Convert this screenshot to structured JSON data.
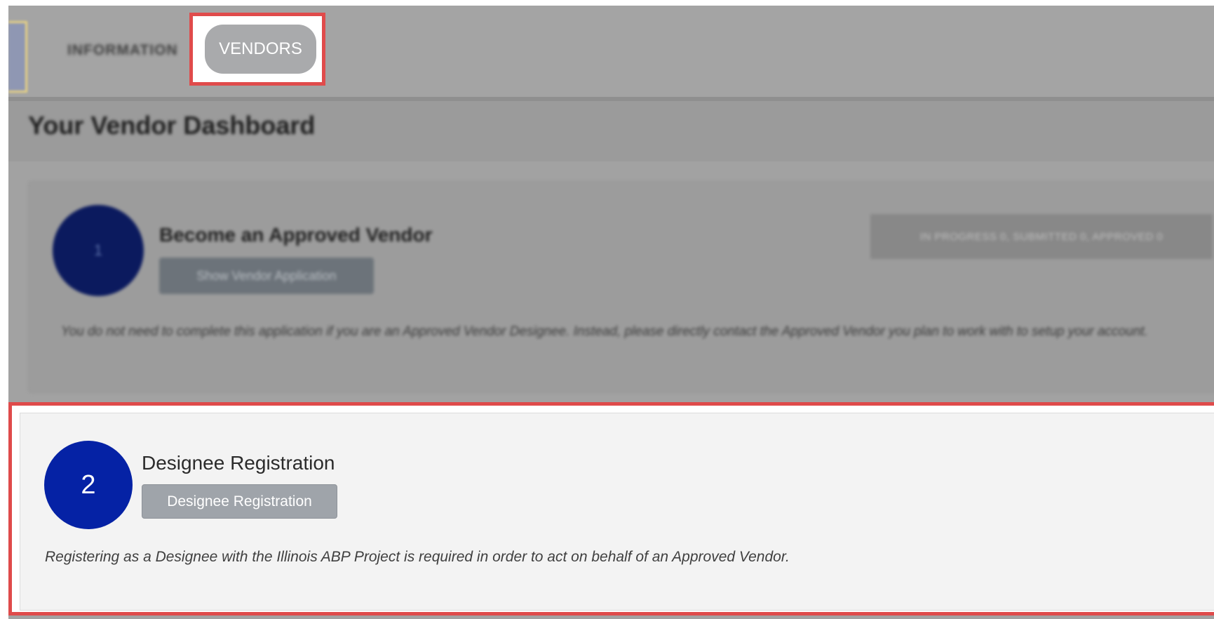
{
  "nav": {
    "information_label": "INFORMATION",
    "vendors_label": "VENDORS"
  },
  "dashboard": {
    "title": "Your Vendor Dashboard"
  },
  "cards": [
    {
      "step": "1",
      "title": "Become an Approved Vendor",
      "button_label": "Show Vendor Application",
      "status": "IN PROGRESS 0, SUBMITTED 0, APPROVED 0",
      "description": "You do not need to complete this application if you are an Approved Vendor Designee. Instead, please directly contact the Approved Vendor you plan to work with to setup your account."
    },
    {
      "step": "2",
      "title": "Designee Registration",
      "button_label": "Designee Registration",
      "description": "Registering as a Designee with the Illinois ABP Project is required in order to act on behalf of an Approved Vendor."
    }
  ],
  "colors": {
    "highlight": "#e04b4b",
    "step_circle": "#0522a5",
    "overlay": "#a2a2a2"
  }
}
